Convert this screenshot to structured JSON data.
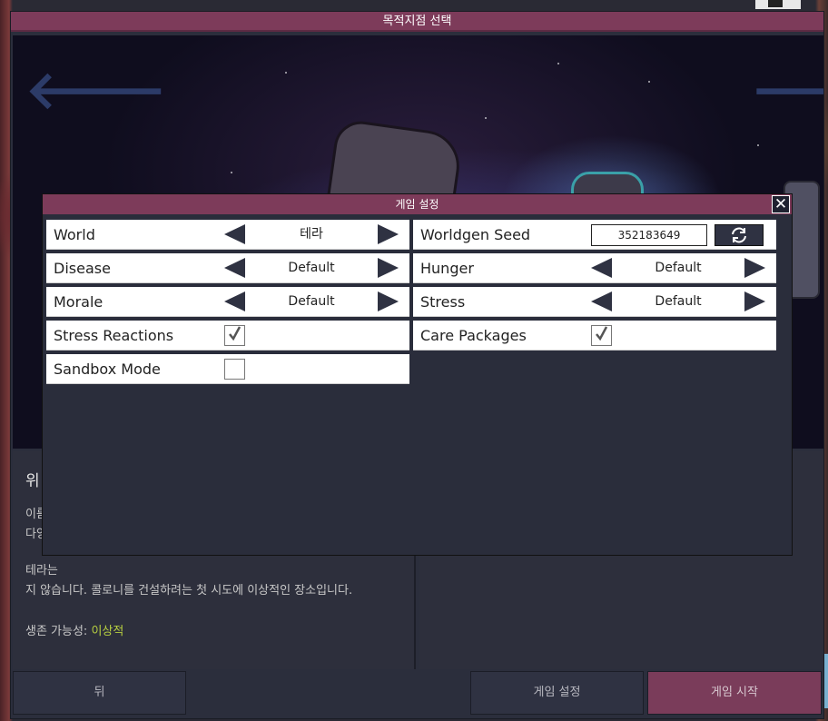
{
  "main": {
    "title": "목적지점 선택",
    "info": {
      "title": "위",
      "text1_line1": "이름",
      "text1_line2": "다양",
      "text2_line1": "테라는 ",
      "text2_line2": "지 않습니다. 콜로니를 건설하려는 첫 시도에 이상적인 장소입니다.",
      "survival_label": "생존 가능성: ",
      "survival_value": "이상적"
    },
    "buttons": {
      "back": "뒤",
      "settings": "게임 설정",
      "start": "게임 시작"
    }
  },
  "modal": {
    "title": "게임 설정",
    "close": "✕",
    "left": [
      {
        "label": "World",
        "type": "cycle",
        "value": "테라"
      },
      {
        "label": "Disease",
        "type": "cycle",
        "value": "Default"
      },
      {
        "label": "Morale",
        "type": "cycle",
        "value": "Default"
      },
      {
        "label": "Stress Reactions",
        "type": "checkbox",
        "checked": true
      },
      {
        "label": "Sandbox Mode",
        "type": "checkbox",
        "checked": false
      }
    ],
    "right": [
      {
        "label": "Worldgen Seed",
        "type": "seed",
        "value": "352183649"
      },
      {
        "label": "Hunger",
        "type": "cycle",
        "value": "Default"
      },
      {
        "label": "Stress",
        "type": "cycle",
        "value": "Default"
      },
      {
        "label": "Care Packages",
        "type": "checkbox",
        "checked": true
      }
    ]
  },
  "colors": {
    "accent": "#7d3b5a",
    "panel": "#2a2d3b",
    "survival_good": "#b8d040"
  }
}
